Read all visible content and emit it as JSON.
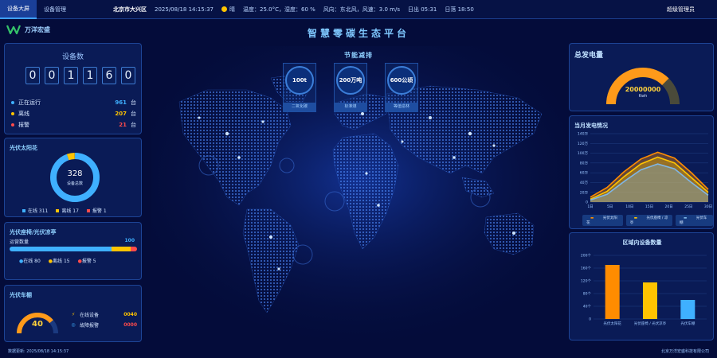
{
  "topbar": {
    "tabs": [
      {
        "label": "设备大屏",
        "active": true
      },
      {
        "label": "设备管理",
        "active": false
      }
    ],
    "location": "北京市大兴区",
    "datetime": "2025/08/18 14:15:37",
    "weather": "晴",
    "temp_humidity": "温度：25.0°C，湿度：60 %",
    "wind": "风向：东北风，风速：3.0 m/s",
    "sunrise": "日出 05:31",
    "sunset": "日落 18:50",
    "user": "超级管理员"
  },
  "logo": {
    "text": "万洋宏盛"
  },
  "title": "智慧零碳生态平台",
  "device_count": {
    "title": "设备数",
    "digits": [
      "0",
      "0",
      "1",
      "1",
      "6",
      "0"
    ],
    "rows": [
      {
        "label": "正在运行",
        "value": "961",
        "unit": "台",
        "color": "#3fb0ff"
      },
      {
        "label": "离线",
        "value": "207",
        "unit": "台",
        "color": "#ffc400"
      },
      {
        "label": "报警",
        "value": "21",
        "unit": "台",
        "color": "#ff4b4b"
      }
    ]
  },
  "pv_sunflower": {
    "title": "光伏太阳花",
    "total": "328",
    "total_label": "设备总数",
    "online": 311,
    "offline": 17,
    "alarm": 1,
    "legend": [
      "在线 311",
      "离线 17",
      "报警 1"
    ]
  },
  "pv_ptz": {
    "title": "光伏座椅/光伏凉亭",
    "bar_label": "运营数量",
    "total": "100",
    "online": 80,
    "offline": 15,
    "alarm": 5,
    "legend": [
      "在线 80",
      "离线 15",
      "报警 5"
    ]
  },
  "pv_shed": {
    "title": "光伏车棚",
    "gauge_value": "40",
    "rows": [
      {
        "label": "在线设备",
        "value": "0040"
      },
      {
        "label": "故障报警",
        "value": "0000"
      }
    ]
  },
  "energy": {
    "title": "节能减排",
    "items": [
      {
        "value": "100t",
        "label": "二氧化碳"
      },
      {
        "value": "200万吨",
        "label": "标准煤"
      },
      {
        "value": "600公顷",
        "label": "等值造林"
      }
    ]
  },
  "power": {
    "title": "总发电量",
    "value": "20000000",
    "unit": "Kwh",
    "fill_fraction": 0.75
  },
  "monthly": {
    "title": "当月发电情况",
    "legend": [
      "光伏太阳花",
      "光伏座椅 / 凉亭",
      "光伏车棚"
    ]
  },
  "region": {
    "title": "区域内设备数量"
  },
  "footer": {
    "updated": "数据更新: 2025/08/18 14:15:37",
    "company": "北京万洋宏盛科技有限公司"
  },
  "colors": {
    "blue": "#3fb0ff",
    "yellow": "#ffc400",
    "orange": "#ff8c00",
    "red": "#ff4b4b"
  },
  "chart_data": [
    {
      "type": "area",
      "title": "当月发电情况",
      "x": [
        "1日",
        "5日",
        "10日",
        "15日",
        "20日",
        "25日",
        "30日"
      ],
      "ylim": [
        0,
        140
      ],
      "y_unit": "万",
      "y_ticks": [
        "0",
        "20万",
        "40万",
        "60万",
        "80万",
        "100万",
        "120万",
        "140万"
      ],
      "series": [
        {
          "name": "光伏太阳花",
          "color": "#ff8c00",
          "values": [
            10,
            30,
            62,
            88,
            102,
            90,
            60,
            26
          ]
        },
        {
          "name": "光伏座椅 / 凉亭",
          "color": "#ffc400",
          "values": [
            6,
            22,
            52,
            78,
            92,
            80,
            50,
            20
          ]
        },
        {
          "name": "光伏车棚",
          "color": "#7fb6e6",
          "values": [
            4,
            16,
            42,
            66,
            78,
            68,
            40,
            14
          ]
        }
      ],
      "grid": true,
      "legend_position": "bottom"
    },
    {
      "type": "bar",
      "title": "区域内设备数量",
      "categories": [
        "光伏太阳花",
        "光伏座椅 / 光伏凉亭",
        "光伏车棚"
      ],
      "values": [
        170,
        115,
        60
      ],
      "colors": [
        "#ff8c00",
        "#ffc400",
        "#3fb0ff"
      ],
      "ylim": [
        0,
        200
      ],
      "y_ticks": [
        "0",
        "40个",
        "80个",
        "120个",
        "160个",
        "200个"
      ]
    }
  ]
}
